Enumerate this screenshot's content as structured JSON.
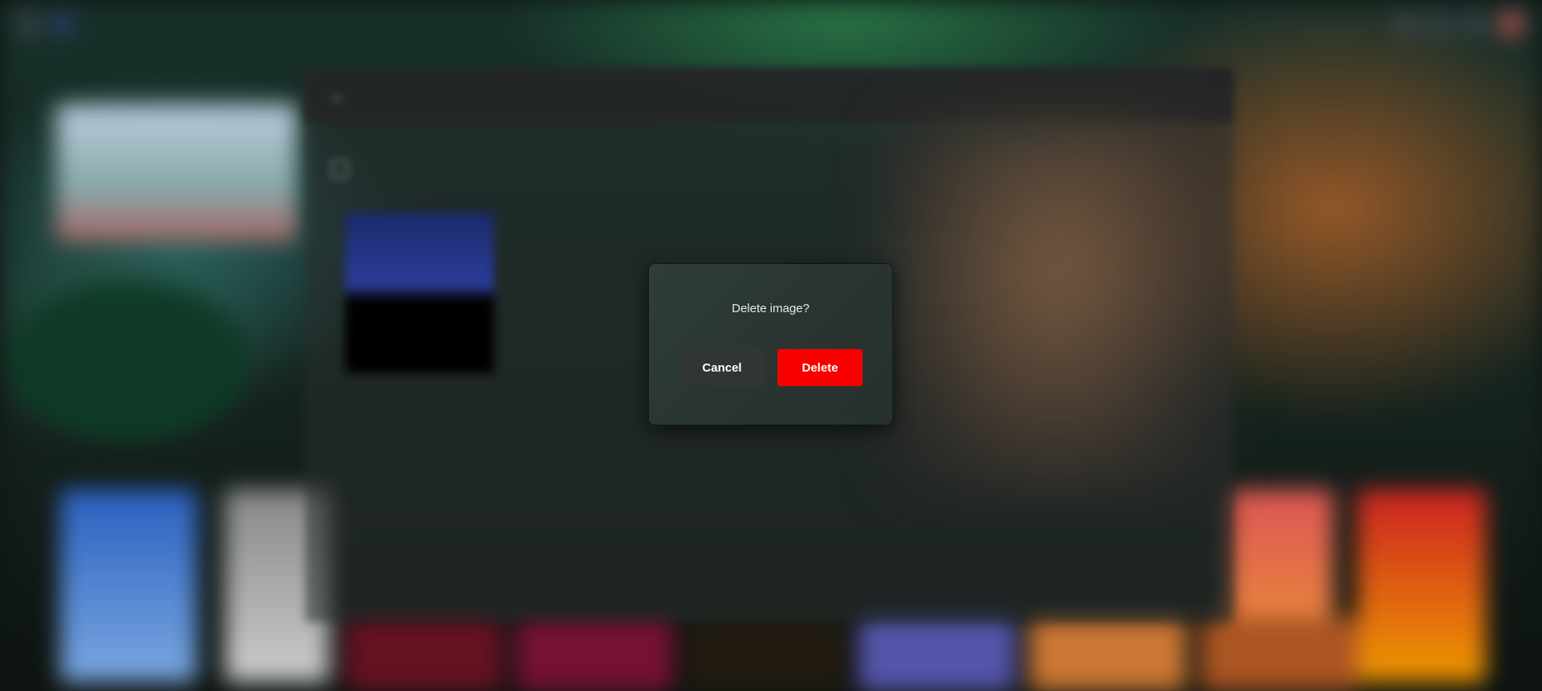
{
  "dialog": {
    "message": "Delete image?",
    "cancel_label": "Cancel",
    "delete_label": "Delete"
  },
  "colors": {
    "delete_button": "#f80000",
    "cancel_button": "#323535",
    "dialog_background": "#2f3d38"
  },
  "background": {
    "icons": [
      "menu-icon",
      "logo-icon",
      "search-icon",
      "settings-icon",
      "cast-icon",
      "avatar"
    ],
    "editor_panel": {
      "icons": [
        "back-arrow-icon",
        "add-icon"
      ]
    }
  }
}
